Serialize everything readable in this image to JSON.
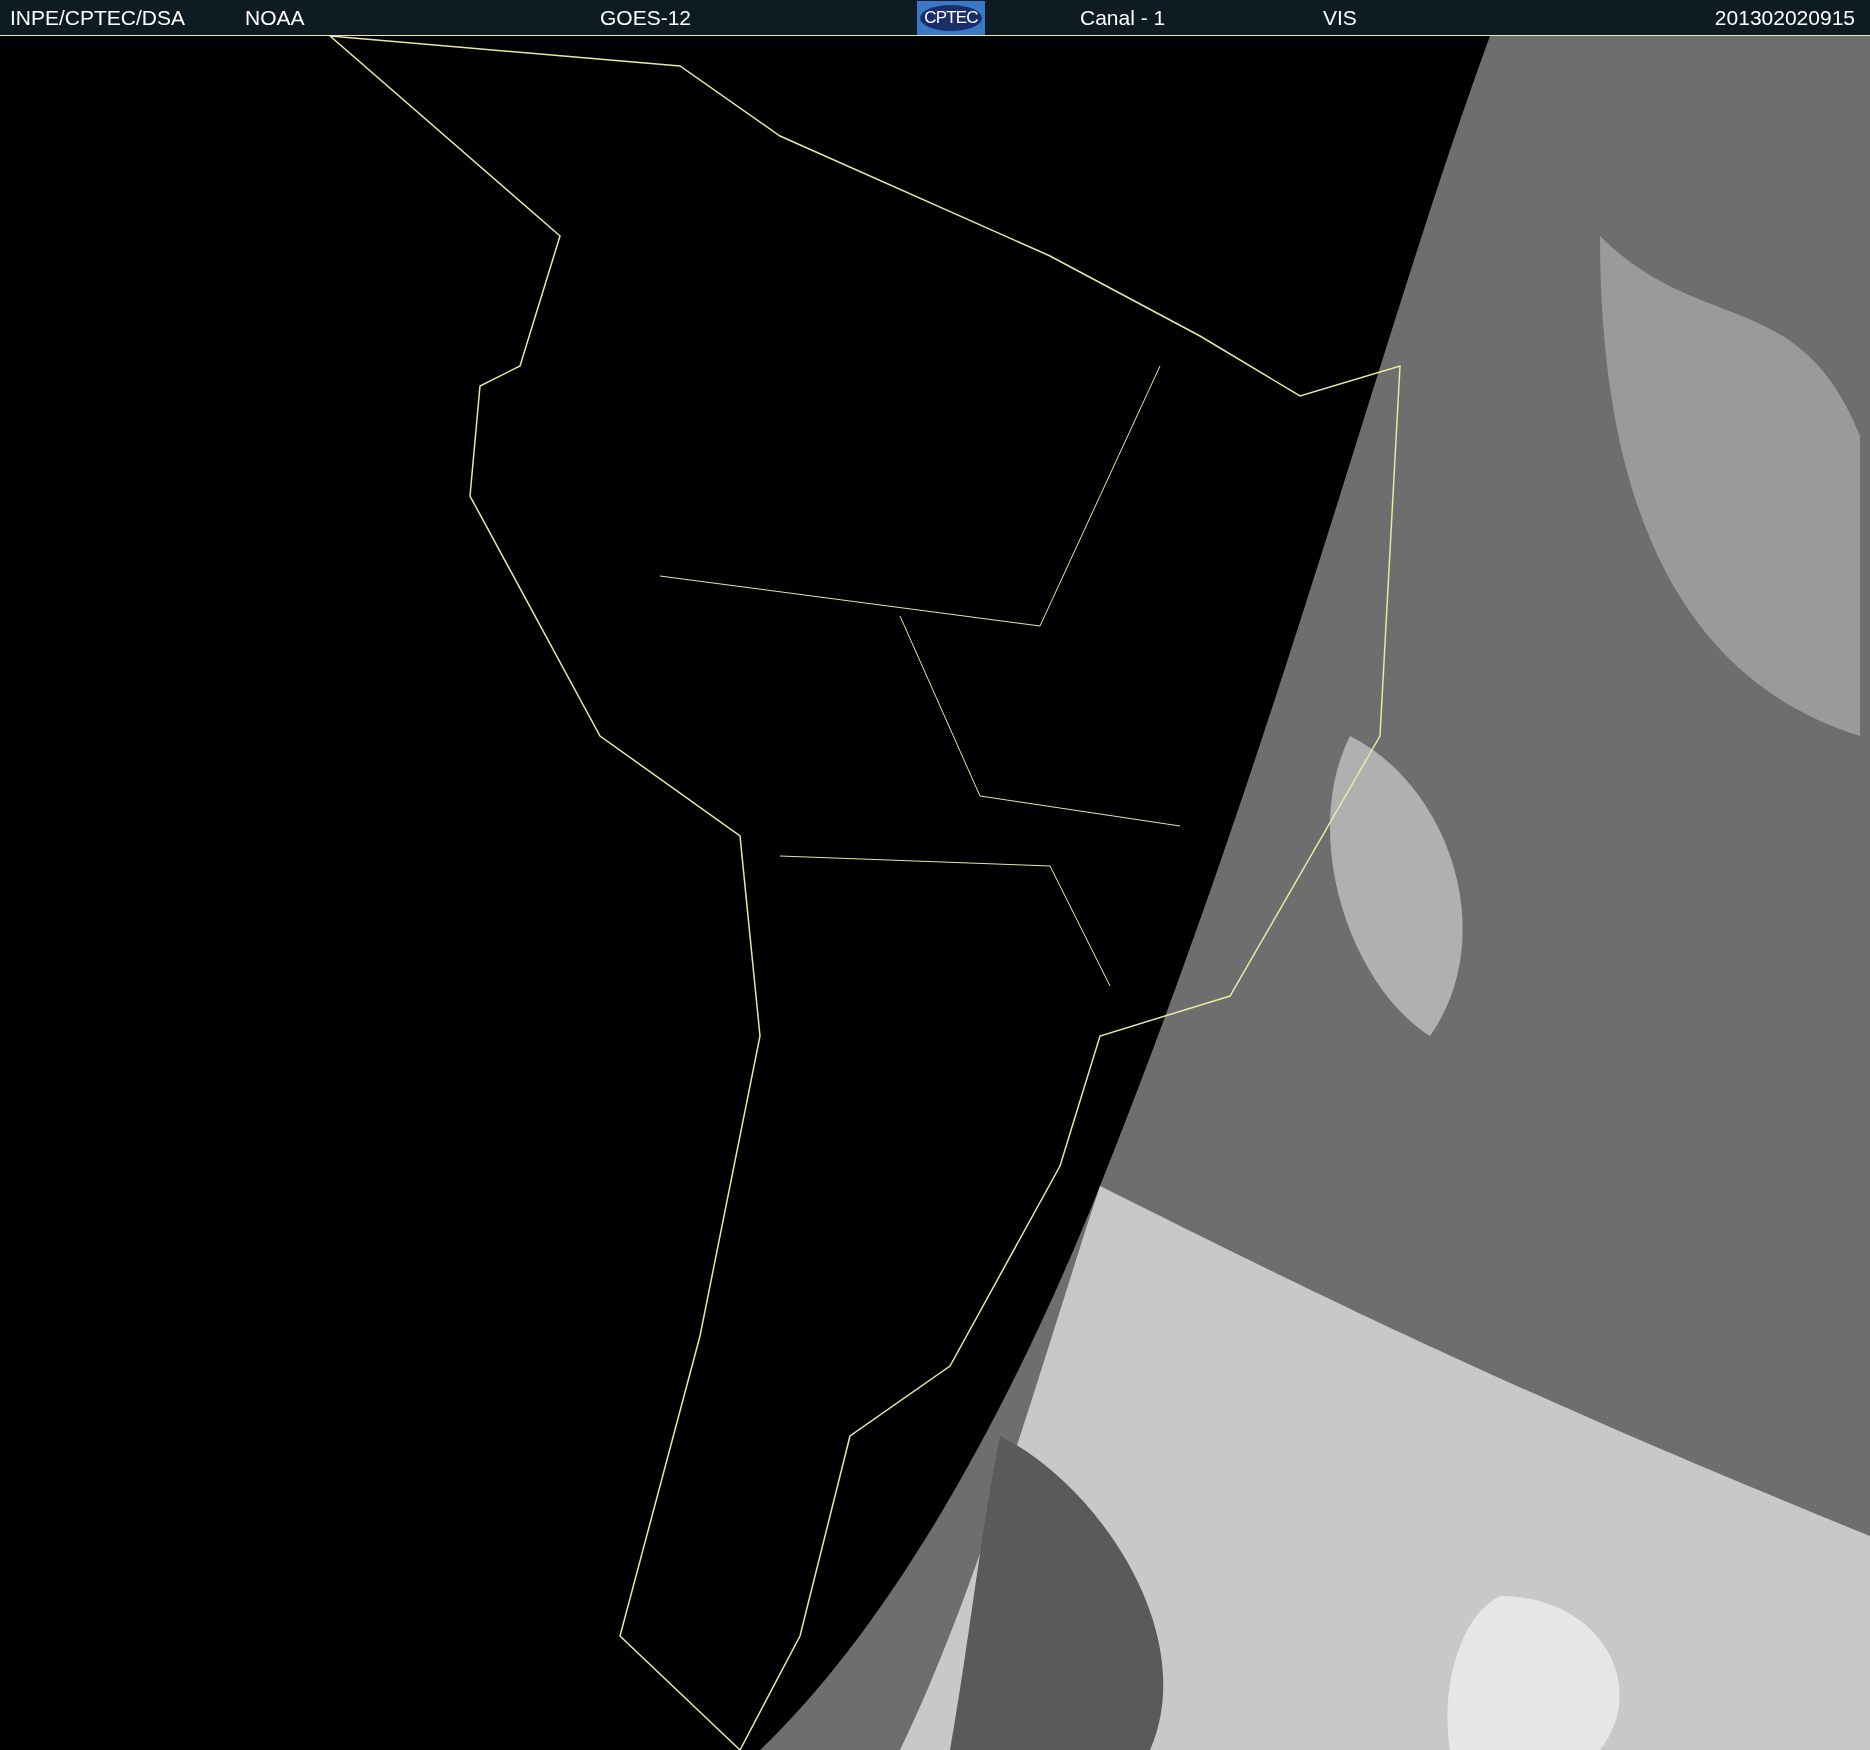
{
  "header": {
    "source": "INPE/CPTEC/DSA",
    "agency": "NOAA",
    "satellite": "GOES-12",
    "logo": "CPTEC",
    "channel": "Canal - 1",
    "band": "VIS",
    "timestamp": "201302020915"
  }
}
